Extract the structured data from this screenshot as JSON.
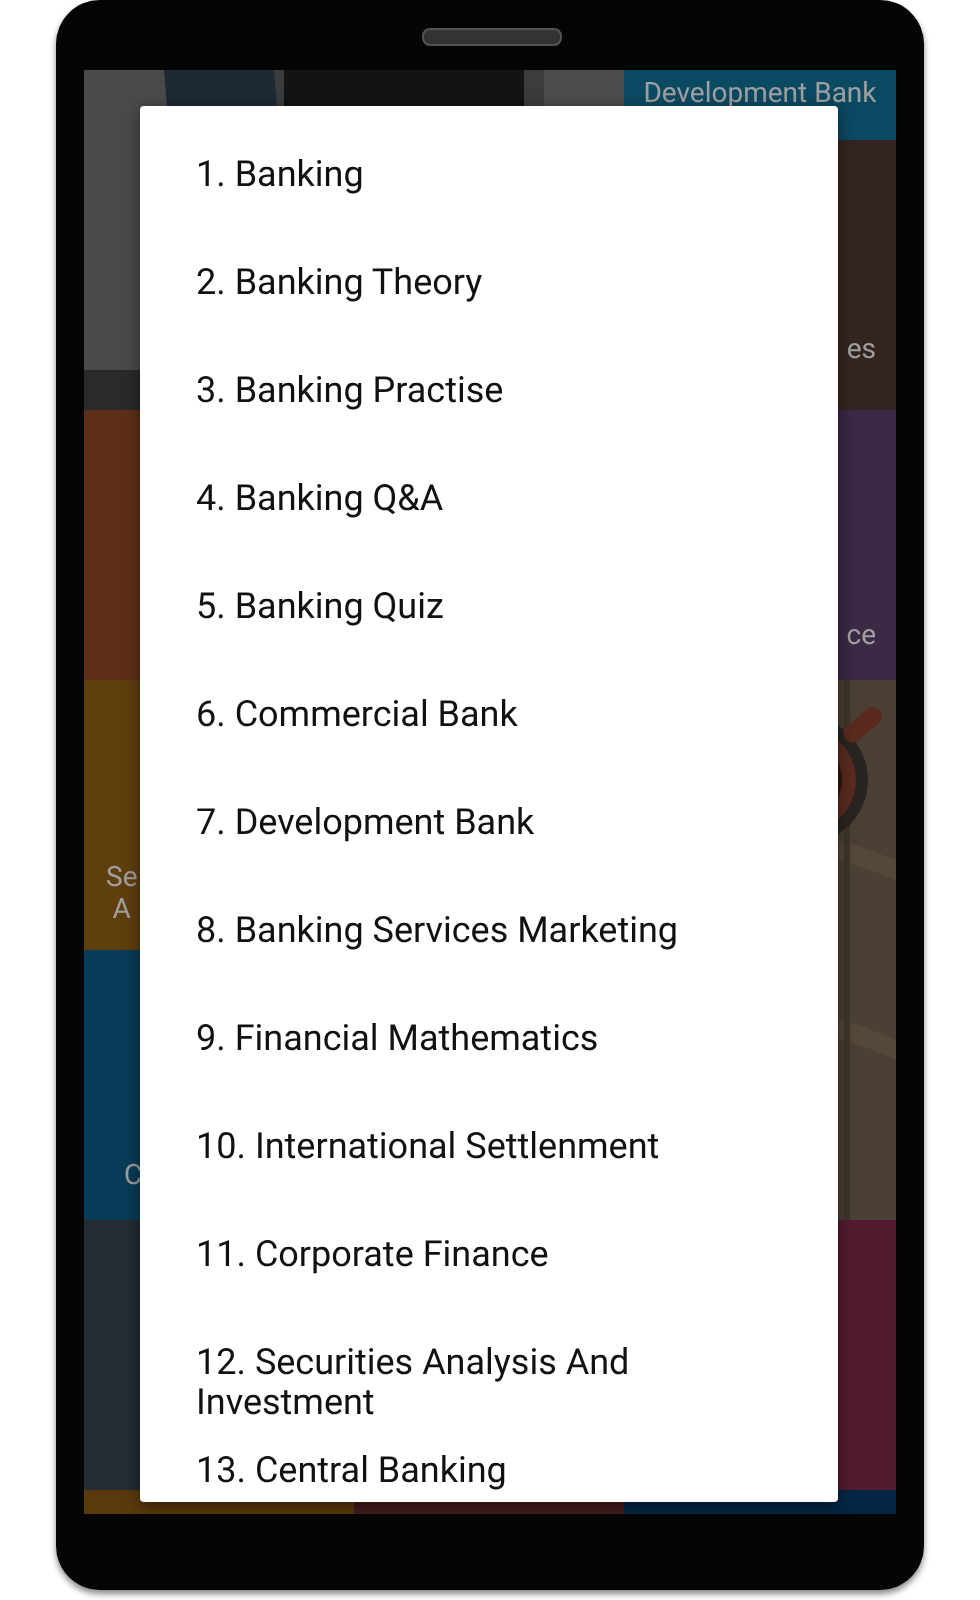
{
  "background_tiles": [
    {
      "kind": "picture"
    },
    {
      "kind": "tile",
      "label": "Development Bank",
      "color": "#0b4a63"
    },
    {
      "kind": "tile",
      "label": "es",
      "color": "#352521"
    },
    {
      "kind": "tile",
      "color": "#5e2f17"
    },
    {
      "kind": "tile",
      "label": "ce",
      "color": "#3b2945"
    },
    {
      "kind": "tile",
      "label": "Se\nA",
      "color": "#603f0e"
    },
    {
      "kind": "picture"
    },
    {
      "kind": "tile",
      "label": "C",
      "color": "#073d58"
    },
    {
      "kind": "tile",
      "color": "#252c33"
    },
    {
      "kind": "tile",
      "color": "#541a30"
    },
    {
      "kind": "tile",
      "color": "#5a3a0c"
    },
    {
      "kind": "tile",
      "color": "#451c1c"
    },
    {
      "kind": "tile",
      "color": "#032745"
    }
  ],
  "dialog": {
    "items": [
      "1. Banking",
      "2. Banking Theory",
      "3. Banking Practise",
      "4. Banking Q&A",
      "5. Banking Quiz",
      "6. Commercial Bank",
      "7. Development Bank",
      "8. Banking Services Marketing",
      "9. Financial Mathematics",
      "10. International Settlenment",
      "11. Corporate Finance",
      "12. Securities Analysis And Investment",
      "13. Central Banking"
    ]
  }
}
